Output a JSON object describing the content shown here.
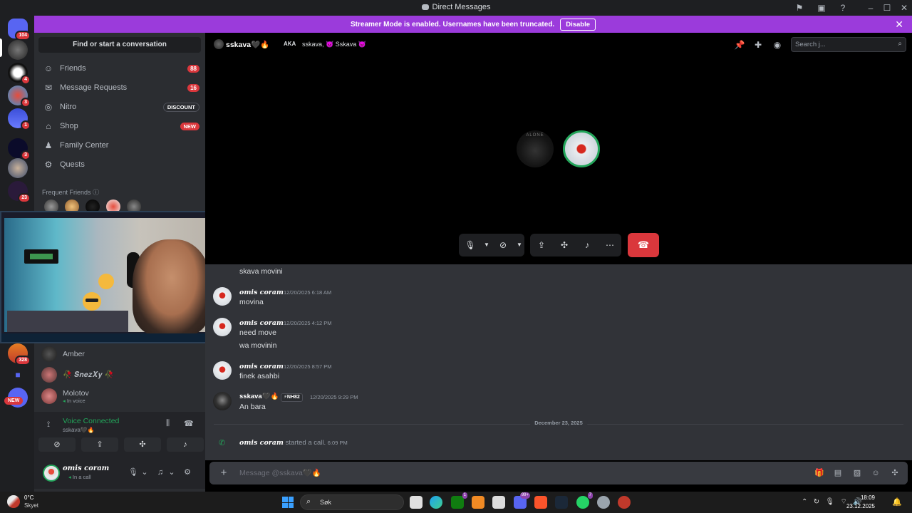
{
  "titlebar": {
    "title": "Direct Messages"
  },
  "banner": {
    "text": "Streamer Mode is enabled. Usernames have been truncated.",
    "button": "Disable"
  },
  "rail": {
    "badges": [
      "104",
      "4",
      "3",
      "1",
      "3",
      "23",
      "328"
    ],
    "new_label": "NEW"
  },
  "sidebar": {
    "search_label": "Find or start a conversation",
    "nav": [
      {
        "label": "Friends",
        "badge": "88",
        "icon": "friends-icon"
      },
      {
        "label": "Message Requests",
        "badge": "16",
        "icon": "mail-icon"
      },
      {
        "label": "Nitro",
        "badge": "DISCOUNT",
        "icon": "nitro-icon"
      },
      {
        "label": "Shop",
        "badge": "NEW",
        "icon": "shop-icon"
      },
      {
        "label": "Family Center",
        "icon": "family-icon"
      },
      {
        "label": "Quests",
        "icon": "quests-icon"
      }
    ],
    "frequent_label": "Frequent Friends",
    "dms": [
      {
        "name": "Amber"
      },
      {
        "name": "🥀 𝑺𝒏𝒆𝒛𝑿𝒚 🥀"
      },
      {
        "name": "Molotov",
        "status": "In voice"
      }
    ]
  },
  "voice": {
    "title": "Voice Connected",
    "subtitle": "sskava🖤🔥"
  },
  "user": {
    "name": "omis coram",
    "status": "In a call"
  },
  "header": {
    "name": "sskava🖤🔥",
    "aka_label": "AKA",
    "aka_names": "sskava, 👿 Sskava 👿",
    "search_placeholder": "Search j..."
  },
  "call": {
    "avatar1_text": "ALONE"
  },
  "messages": [
    {
      "text": "skava movini"
    },
    {
      "author": "omis coram",
      "time": "12/20/2025 6:18 AM",
      "text": "movina"
    },
    {
      "author": "omis coram",
      "time": "12/20/2025 4:12 PM",
      "text": "need move",
      "text2": "wa movinin"
    },
    {
      "author": "omis coram",
      "time": "12/20/2025 8:57 PM",
      "text": "finek asahbi"
    },
    {
      "author": "sskava🖤🔥",
      "tag": "⚡NH82",
      "time": "12/20/2025 9:29 PM",
      "text": "An bara"
    }
  ],
  "divider": {
    "date": "December 23, 2025"
  },
  "system": {
    "who": "omis coram",
    "action": " started a call. ",
    "time": "6:09 PM"
  },
  "composer": {
    "placeholder": "Message @sskava🖤🔥"
  },
  "taskbar": {
    "temp": "0°C",
    "weather": "Skyet",
    "search": "Søk",
    "time": "18:09",
    "date": "23.12.2025",
    "badges": [
      "1",
      "99+",
      "7"
    ]
  }
}
